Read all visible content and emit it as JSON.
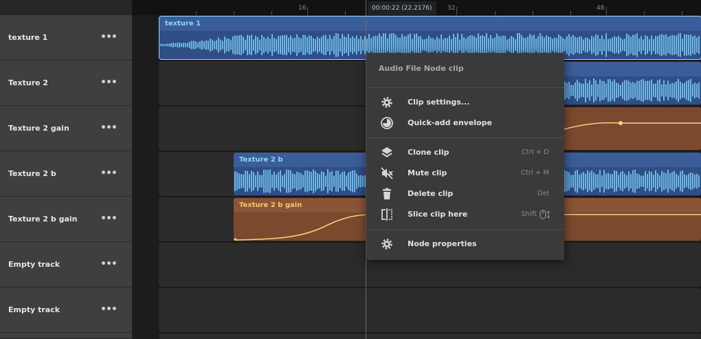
{
  "tracks": [
    {
      "name": "texture 1",
      "menu": "•••"
    },
    {
      "name": "Texture 2",
      "menu": "•••"
    },
    {
      "name": "Texture 2 gain",
      "menu": "•••"
    },
    {
      "name": "Texture 2 b",
      "menu": "•••"
    },
    {
      "name": "Texture 2 b gain",
      "menu": "•••"
    },
    {
      "name": "Empty track",
      "menu": "•••"
    },
    {
      "name": "Empty track",
      "menu": "•••"
    }
  ],
  "ruler": {
    "labels": [
      "16",
      "32",
      "48"
    ],
    "playhead_time": "00:00:22 (22.2176)"
  },
  "clips": {
    "texture1": "texture 1",
    "texture2b": "Texture 2 b",
    "texture2b_gain": "Texture 2 b gain"
  },
  "context_menu": {
    "title": "Audio File Node clip",
    "items": [
      {
        "label": "Clip settings...",
        "icon": "gear-icon",
        "shortcut": ""
      },
      {
        "label": "Quick-add envelope",
        "icon": "envelope-icon",
        "shortcut": ""
      },
      {
        "label": "Clone clip",
        "icon": "layers-icon",
        "shortcut": "Ctrl + D"
      },
      {
        "label": "Mute clip",
        "icon": "mute-icon",
        "shortcut": "Ctrl + M"
      },
      {
        "label": "Delete clip",
        "icon": "trash-icon",
        "shortcut": "Del"
      },
      {
        "label": "Slice clip here",
        "icon": "slice-icon",
        "shortcut": "Shift"
      },
      {
        "label": "Node properties",
        "icon": "gear-icon",
        "shortcut": ""
      }
    ]
  },
  "colors": {
    "audio_clip": "#2f4e86",
    "audio_wave": "#7fd4ff",
    "envelope_clip": "#7b4a2e",
    "envelope_curve": "#ffcf7a",
    "menu_bg": "#3a3a3a"
  }
}
